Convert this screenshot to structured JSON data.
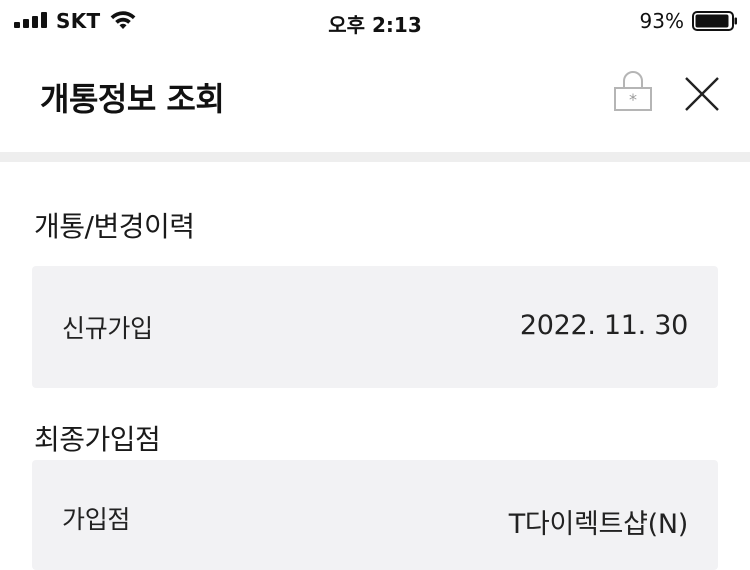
{
  "status": {
    "carrier": "SKT",
    "time": "오후 2:13",
    "battery_percent": "93%",
    "battery_level": 0.93,
    "icons": [
      "signal-icon",
      "wifi-icon",
      "battery-icon"
    ]
  },
  "header": {
    "title": "개통정보 조회",
    "icons": [
      "lock-icon",
      "close-icon"
    ]
  },
  "sections": {
    "history": {
      "title": "개통/변경이력",
      "label": "신규가입",
      "value": "2022. 11. 30"
    },
    "store": {
      "title": "최종가입점",
      "label": "가입점",
      "value": "T다이렉트샵(N)"
    }
  },
  "colors": {
    "card_bg": "#f2f2f4",
    "divider": "#eeeeee",
    "icon_gray": "#b5b5b5"
  }
}
